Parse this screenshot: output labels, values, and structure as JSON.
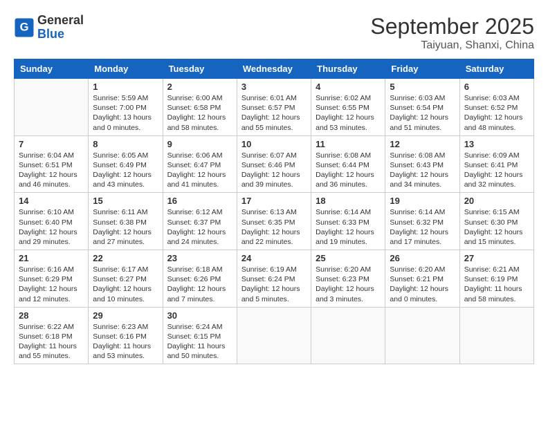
{
  "header": {
    "logo_general": "General",
    "logo_blue": "Blue",
    "month_title": "September 2025",
    "location": "Taiyuan, Shanxi, China"
  },
  "weekdays": [
    "Sunday",
    "Monday",
    "Tuesday",
    "Wednesday",
    "Thursday",
    "Friday",
    "Saturday"
  ],
  "weeks": [
    [
      {
        "day": "",
        "info": ""
      },
      {
        "day": "1",
        "info": "Sunrise: 5:59 AM\nSunset: 7:00 PM\nDaylight: 13 hours\nand 0 minutes."
      },
      {
        "day": "2",
        "info": "Sunrise: 6:00 AM\nSunset: 6:58 PM\nDaylight: 12 hours\nand 58 minutes."
      },
      {
        "day": "3",
        "info": "Sunrise: 6:01 AM\nSunset: 6:57 PM\nDaylight: 12 hours\nand 55 minutes."
      },
      {
        "day": "4",
        "info": "Sunrise: 6:02 AM\nSunset: 6:55 PM\nDaylight: 12 hours\nand 53 minutes."
      },
      {
        "day": "5",
        "info": "Sunrise: 6:03 AM\nSunset: 6:54 PM\nDaylight: 12 hours\nand 51 minutes."
      },
      {
        "day": "6",
        "info": "Sunrise: 6:03 AM\nSunset: 6:52 PM\nDaylight: 12 hours\nand 48 minutes."
      }
    ],
    [
      {
        "day": "7",
        "info": "Sunrise: 6:04 AM\nSunset: 6:51 PM\nDaylight: 12 hours\nand 46 minutes."
      },
      {
        "day": "8",
        "info": "Sunrise: 6:05 AM\nSunset: 6:49 PM\nDaylight: 12 hours\nand 43 minutes."
      },
      {
        "day": "9",
        "info": "Sunrise: 6:06 AM\nSunset: 6:47 PM\nDaylight: 12 hours\nand 41 minutes."
      },
      {
        "day": "10",
        "info": "Sunrise: 6:07 AM\nSunset: 6:46 PM\nDaylight: 12 hours\nand 39 minutes."
      },
      {
        "day": "11",
        "info": "Sunrise: 6:08 AM\nSunset: 6:44 PM\nDaylight: 12 hours\nand 36 minutes."
      },
      {
        "day": "12",
        "info": "Sunrise: 6:08 AM\nSunset: 6:43 PM\nDaylight: 12 hours\nand 34 minutes."
      },
      {
        "day": "13",
        "info": "Sunrise: 6:09 AM\nSunset: 6:41 PM\nDaylight: 12 hours\nand 32 minutes."
      }
    ],
    [
      {
        "day": "14",
        "info": "Sunrise: 6:10 AM\nSunset: 6:40 PM\nDaylight: 12 hours\nand 29 minutes."
      },
      {
        "day": "15",
        "info": "Sunrise: 6:11 AM\nSunset: 6:38 PM\nDaylight: 12 hours\nand 27 minutes."
      },
      {
        "day": "16",
        "info": "Sunrise: 6:12 AM\nSunset: 6:37 PM\nDaylight: 12 hours\nand 24 minutes."
      },
      {
        "day": "17",
        "info": "Sunrise: 6:13 AM\nSunset: 6:35 PM\nDaylight: 12 hours\nand 22 minutes."
      },
      {
        "day": "18",
        "info": "Sunrise: 6:14 AM\nSunset: 6:33 PM\nDaylight: 12 hours\nand 19 minutes."
      },
      {
        "day": "19",
        "info": "Sunrise: 6:14 AM\nSunset: 6:32 PM\nDaylight: 12 hours\nand 17 minutes."
      },
      {
        "day": "20",
        "info": "Sunrise: 6:15 AM\nSunset: 6:30 PM\nDaylight: 12 hours\nand 15 minutes."
      }
    ],
    [
      {
        "day": "21",
        "info": "Sunrise: 6:16 AM\nSunset: 6:29 PM\nDaylight: 12 hours\nand 12 minutes."
      },
      {
        "day": "22",
        "info": "Sunrise: 6:17 AM\nSunset: 6:27 PM\nDaylight: 12 hours\nand 10 minutes."
      },
      {
        "day": "23",
        "info": "Sunrise: 6:18 AM\nSunset: 6:26 PM\nDaylight: 12 hours\nand 7 minutes."
      },
      {
        "day": "24",
        "info": "Sunrise: 6:19 AM\nSunset: 6:24 PM\nDaylight: 12 hours\nand 5 minutes."
      },
      {
        "day": "25",
        "info": "Sunrise: 6:20 AM\nSunset: 6:23 PM\nDaylight: 12 hours\nand 3 minutes."
      },
      {
        "day": "26",
        "info": "Sunrise: 6:20 AM\nSunset: 6:21 PM\nDaylight: 12 hours\nand 0 minutes."
      },
      {
        "day": "27",
        "info": "Sunrise: 6:21 AM\nSunset: 6:19 PM\nDaylight: 11 hours\nand 58 minutes."
      }
    ],
    [
      {
        "day": "28",
        "info": "Sunrise: 6:22 AM\nSunset: 6:18 PM\nDaylight: 11 hours\nand 55 minutes."
      },
      {
        "day": "29",
        "info": "Sunrise: 6:23 AM\nSunset: 6:16 PM\nDaylight: 11 hours\nand 53 minutes."
      },
      {
        "day": "30",
        "info": "Sunrise: 6:24 AM\nSunset: 6:15 PM\nDaylight: 11 hours\nand 50 minutes."
      },
      {
        "day": "",
        "info": ""
      },
      {
        "day": "",
        "info": ""
      },
      {
        "day": "",
        "info": ""
      },
      {
        "day": "",
        "info": ""
      }
    ]
  ]
}
